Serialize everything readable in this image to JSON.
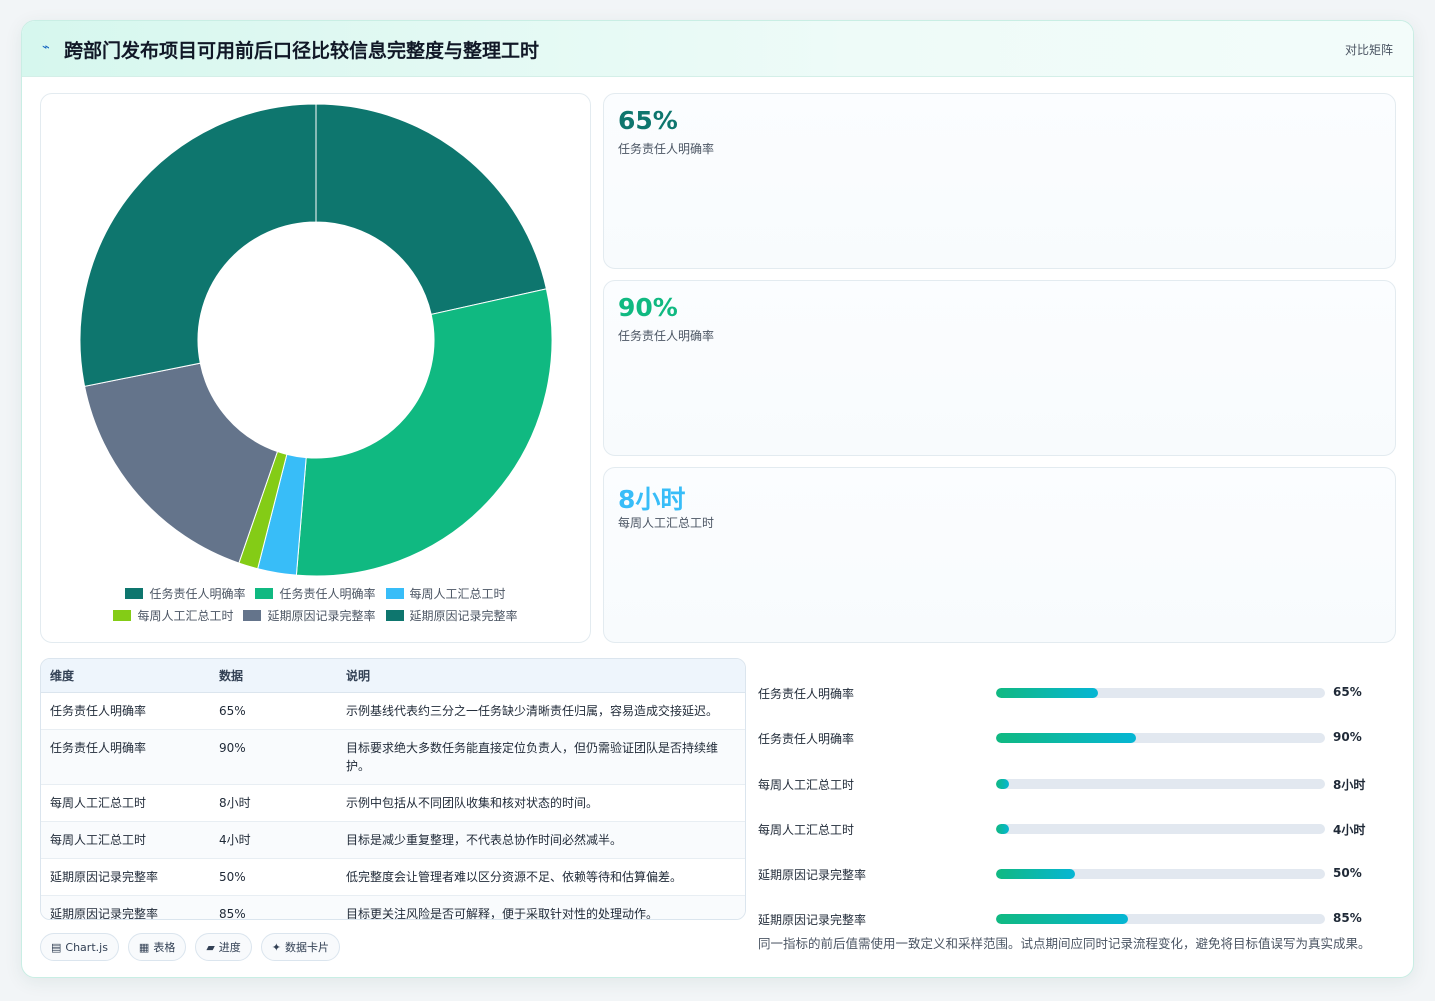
{
  "header": {
    "logo_icon": "chart-line-icon",
    "title": "跨部门发布项目可用前后口径比较信息完整度与整理工时",
    "tag": "对比矩阵"
  },
  "colors": {
    "teal_dark": "#0e766e",
    "green": "#10b981",
    "sky": "#38bdf8",
    "lime": "#84cc16",
    "slate": "#64748b"
  },
  "chart_data": {
    "type": "pie",
    "donut": true,
    "slices": [
      {
        "label": "任务责任人明确率",
        "value": 65,
        "color": "#0e766e"
      },
      {
        "label": "任务责任人明确率",
        "value": 90,
        "color": "#10b981"
      },
      {
        "label": "每周人工汇总工时",
        "value": 8,
        "color": "#38bdf8"
      },
      {
        "label": "每周人工汇总工时",
        "value": 4,
        "color": "#84cc16"
      },
      {
        "label": "延期原因记录完整率",
        "value": 50,
        "color": "#64748b"
      },
      {
        "label": "延期原因记录完整率",
        "value": 85,
        "color": "#0e766e"
      }
    ],
    "legend_position": "bottom"
  },
  "legend": {
    "row1": [
      "任务责任人明确率",
      "任务责任人明确率",
      "每周人工汇总工时"
    ],
    "row2": [
      "每周人工汇总工时",
      "延期原因记录完整率",
      "延期原因记录完整率"
    ]
  },
  "kpis": [
    {
      "value": "65%",
      "label": "任务责任人明确率",
      "color": "#0e766e"
    },
    {
      "value": "90%",
      "label": "任务责任人明确率",
      "color": "#10b981"
    },
    {
      "value": "8小时",
      "label": "每周人工汇总工时",
      "color": "#38bdf8"
    }
  ],
  "table": {
    "headers": [
      "维度",
      "数据",
      "说明"
    ],
    "rows": [
      [
        "任务责任人明确率",
        "65%",
        "示例基线代表约三分之一任务缺少清晰责任归属，容易造成交接延迟。"
      ],
      [
        "任务责任人明确率",
        "90%",
        "目标要求绝大多数任务能直接定位负责人，但仍需验证团队是否持续维护。"
      ],
      [
        "每周人工汇总工时",
        "8小时",
        "示例中包括从不同团队收集和核对状态的时间。"
      ],
      [
        "每周人工汇总工时",
        "4小时",
        "目标是减少重复整理，不代表总协作时间必然减半。"
      ],
      [
        "延期原因记录完整率",
        "50%",
        "低完整度会让管理者难以区分资源不足、依赖等待和估算偏差。"
      ],
      [
        "延期原因记录完整率",
        "85%",
        "目标更关注风险是否可解释，便于采取针对性的处理动作。"
      ]
    ]
  },
  "progress": [
    {
      "label": "任务责任人明确率",
      "value_text": "65%",
      "fraction": 0.31
    },
    {
      "label": "任务责任人明确率",
      "value_text": "90%",
      "fraction": 0.425
    },
    {
      "label": "每周人工汇总工时",
      "value_text": "8小时",
      "fraction": 0.04
    },
    {
      "label": "每周人工汇总工时",
      "value_text": "4小时",
      "fraction": 0.04
    },
    {
      "label": "延期原因记录完整率",
      "value_text": "50%",
      "fraction": 0.24
    },
    {
      "label": "延期原因记录完整率",
      "value_text": "85%",
      "fraction": 0.4
    }
  ],
  "note": "同一指标的前后值需使用一致定义和采样范围。试点期间应同时记录流程变化，避免将目标值误写为真实成果。",
  "chips": [
    {
      "icon": "chart-icon",
      "glyph": "▤",
      "label": "Chart.js"
    },
    {
      "icon": "table-icon",
      "glyph": "▦",
      "label": "表格"
    },
    {
      "icon": "progress-icon",
      "glyph": "▰",
      "label": "进度"
    },
    {
      "icon": "card-icon",
      "glyph": "✦",
      "label": "数据卡片"
    }
  ]
}
